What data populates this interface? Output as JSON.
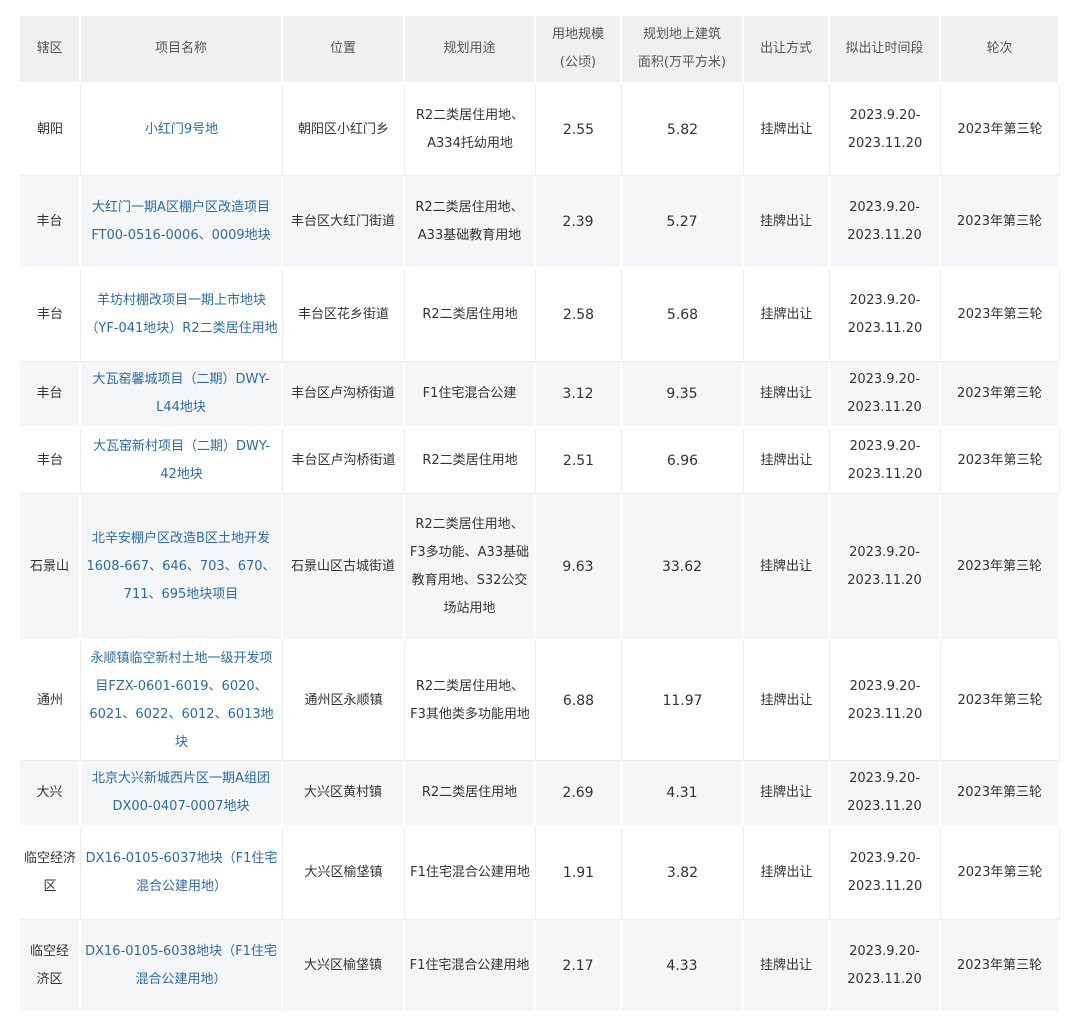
{
  "headers": [
    "辖区",
    "项目名称",
    "位置",
    "规划用途",
    "用地规模（公顷）",
    "规划地上建筑面积(万平方米)",
    "出让方式",
    "拟出让时间段",
    "轮次"
  ],
  "header_lines": {
    "area": [
      "用地规模",
      "(公顷)"
    ],
    "floor": [
      "规划地上建筑",
      "面积(万平方米)"
    ]
  },
  "rows": [
    {
      "district": "朝阳",
      "name": "小红门9号地",
      "location": "朝阳区小红门乡",
      "use": "R2二类居住用地、A334托幼用地",
      "area": "2.55",
      "floor_area": "5.82",
      "method": "挂牌出让",
      "period": "2023.9.20-2023.11.20",
      "round": "2023年第三轮"
    },
    {
      "district": "丰台",
      "name": "大红门一期A区棚户区改造项目FT00-0516-0006、0009地块",
      "location": "丰台区大红门街道",
      "use": "R2二类居住用地、A33基础教育用地",
      "area": "2.39",
      "floor_area": "5.27",
      "method": "挂牌出让",
      "period": "2023.9.20-2023.11.20",
      "round": "2023年第三轮"
    },
    {
      "district": "丰台",
      "name": "羊坊村棚改项目一期上市地块（YF-041地块）R2二类居住用地",
      "location": "丰台区花乡街道",
      "use": "R2二类居住用地",
      "area": "2.58",
      "floor_area": "5.68",
      "method": "挂牌出让",
      "period": "2023.9.20-2023.11.20",
      "round": "2023年第三轮"
    },
    {
      "district": "丰台",
      "name": "大瓦窑馨城项目（二期）DWY-L44地块",
      "location": "丰台区卢沟桥街道",
      "use": "F1住宅混合公建",
      "area": "3.12",
      "floor_area": "9.35",
      "method": "挂牌出让",
      "period": "2023.9.20-2023.11.20",
      "round": "2023年第三轮"
    },
    {
      "district": "丰台",
      "name": "大瓦窑新村项目（二期）DWY-42地块",
      "location": "丰台区卢沟桥街道",
      "use": "R2二类居住用地",
      "area": "2.51",
      "floor_area": "6.96",
      "method": "挂牌出让",
      "period": "2023.9.20-2023.11.20",
      "round": "2023年第三轮"
    },
    {
      "district": "石景山",
      "name": "北辛安棚户区改造B区土地开发1608-667、646、703、670、711、695地块项目",
      "location": "石景山区古城街道",
      "use": "R2二类居住用地、F3多功能、A33基础教育用地、S32公交场站用地",
      "area": "9.63",
      "floor_area": "33.62",
      "method": "挂牌出让",
      "period": "2023.9.20-2023.11.20",
      "round": "2023年第三轮"
    },
    {
      "district": "通州",
      "name": "永顺镇临空新村土地一级开发项目FZX-0601-6019、6020、6021、6022、6012、6013地块",
      "location": "通州区永顺镇",
      "use": "R2二类居住用地、F3其他类多功能用地",
      "area": "6.88",
      "floor_area": "11.97",
      "method": "挂牌出让",
      "period": "2023.9.20-2023.11.20",
      "round": "2023年第三轮"
    },
    {
      "district": "大兴",
      "name": "北京大兴新城西片区一期A组团DX00-0407-0007地块",
      "location": "大兴区黄村镇",
      "use": "R2二类居住用地",
      "area": "2.69",
      "floor_area": "4.31",
      "method": "挂牌出让",
      "period": "2023.9.20-2023.11.20",
      "round": "2023年第三轮"
    },
    {
      "district": "临空经济区",
      "name": "DX16-0105-6037地块（F1住宅混合公建用地）",
      "location": "大兴区榆垡镇",
      "use": "F1住宅混合公建用地",
      "area": "1.91",
      "floor_area": "3.82",
      "method": "挂牌出让",
      "period": "2023.9.20-2023.11.20",
      "round": "2023年第三轮"
    },
    {
      "district": "临空经济区",
      "name": "DX16-0105-6038地块（F1住宅混合公建用地）",
      "location": "大兴区榆垡镇",
      "use": "F1住宅混合公建用地",
      "area": "2.17",
      "floor_area": "4.33",
      "method": "挂牌出让",
      "period": "2023.9.20-2023.11.20",
      "round": "2023年第三轮"
    }
  ]
}
